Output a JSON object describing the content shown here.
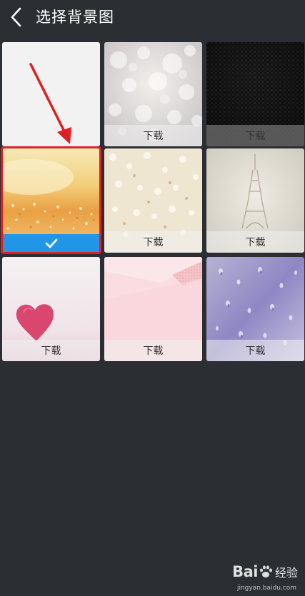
{
  "header": {
    "title": "选择背景图",
    "back_icon": "chevron-left-icon"
  },
  "colors": {
    "background": "#2b2e33",
    "selected_bar": "#2196e8",
    "selected_border": "#e02020",
    "annotation_arrow": "#e02020"
  },
  "grid": {
    "download_label": "下载",
    "tiles": [
      {
        "name": "plain-white",
        "status": "default"
      },
      {
        "name": "silver-bokeh",
        "status": "download"
      },
      {
        "name": "black-carbon",
        "status": "download"
      },
      {
        "name": "golden-glitter",
        "status": "selected"
      },
      {
        "name": "cream-floral",
        "status": "download"
      },
      {
        "name": "eiffel-tower",
        "status": "download"
      },
      {
        "name": "pink-heart",
        "status": "download"
      },
      {
        "name": "pink-paper",
        "status": "download"
      },
      {
        "name": "purple-raindrops",
        "status": "download"
      }
    ]
  },
  "watermark": {
    "logo_text": "Bai",
    "logo_suffix": "经验",
    "url": "jingyan.baidu.com"
  }
}
